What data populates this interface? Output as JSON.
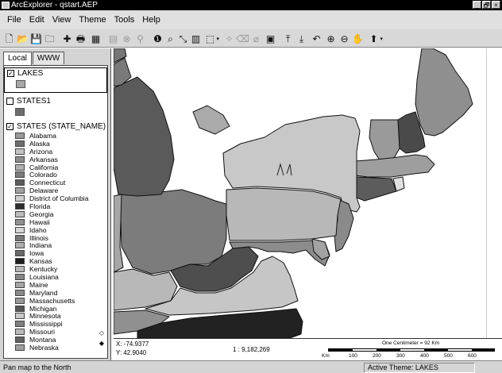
{
  "window": {
    "title": "ArcExplorer - qstart.AEP",
    "controls": [
      "_",
      "🗗",
      "×"
    ]
  },
  "menu": [
    "File",
    "Edit",
    "View",
    "Theme",
    "Tools",
    "Help"
  ],
  "toolbar": [
    {
      "name": "new-icon",
      "glyph": "🗋"
    },
    {
      "name": "open-icon",
      "glyph": "📂"
    },
    {
      "name": "save-icon",
      "glyph": "💾"
    },
    {
      "name": "open-folder-icon",
      "glyph": "🗀"
    },
    {
      "name": "add-theme-icon",
      "glyph": "✚"
    },
    {
      "name": "print-icon",
      "glyph": "🖶"
    },
    {
      "name": "properties-icon",
      "glyph": "▦"
    },
    {
      "name": "table-icon",
      "glyph": "▤",
      "dim": true
    },
    {
      "name": "remove-icon",
      "glyph": "⊗",
      "dim": true
    },
    {
      "name": "query-icon",
      "glyph": "⚲",
      "dim": true
    },
    {
      "name": "identify-icon",
      "glyph": "❶"
    },
    {
      "name": "find-icon",
      "glyph": "⌕"
    },
    {
      "name": "measure-icon",
      "glyph": "⤡"
    },
    {
      "name": "chart-icon",
      "glyph": "▥"
    },
    {
      "name": "select-icon",
      "glyph": "⬚",
      "arrow": true
    },
    {
      "name": "buffer-icon",
      "glyph": "✧",
      "dim": true
    },
    {
      "name": "clear-icon",
      "glyph": "⌫",
      "dim": true
    },
    {
      "name": "erase-icon",
      "glyph": "⌀",
      "dim": true
    },
    {
      "name": "layout-icon",
      "glyph": "▣"
    },
    {
      "name": "export-icon",
      "glyph": "⤒"
    },
    {
      "name": "import-icon",
      "glyph": "⤓"
    },
    {
      "name": "undo-icon",
      "glyph": "↶"
    },
    {
      "name": "zoom-in-icon",
      "glyph": "⊕"
    },
    {
      "name": "zoom-out-icon",
      "glyph": "⊖"
    },
    {
      "name": "pan-icon",
      "glyph": "✋"
    },
    {
      "name": "pan-north-icon",
      "glyph": "⬆",
      "arrow": true
    }
  ],
  "tabs": {
    "local": "Local",
    "www": "WWW"
  },
  "legend": {
    "lakes": {
      "name": "LAKES",
      "checked": true,
      "color": "#a8a8a8"
    },
    "states1": {
      "name": "STATES1",
      "checked": false,
      "color": "#6c6c6c"
    },
    "states": {
      "name": "STATES (STATE_NAME)",
      "checked": true,
      "items": [
        {
          "label": "Alabama",
          "color": "#9a9a9a"
        },
        {
          "label": "Alaska",
          "color": "#6e6e6e"
        },
        {
          "label": "Arizona",
          "color": "#c2c2c2"
        },
        {
          "label": "Arkansas",
          "color": "#8c8c8c"
        },
        {
          "label": "California",
          "color": "#b0b0b0"
        },
        {
          "label": "Colorado",
          "color": "#7a7a7a"
        },
        {
          "label": "Connecticut",
          "color": "#5c5c5c"
        },
        {
          "label": "Delaware",
          "color": "#a2a2a2"
        },
        {
          "label": "District of Columbia",
          "color": "#cfcfcf"
        },
        {
          "label": "Florida",
          "color": "#2c2c2c"
        },
        {
          "label": "Georgia",
          "color": "#bdbdbd"
        },
        {
          "label": "Hawaii",
          "color": "#919191"
        },
        {
          "label": "Idaho",
          "color": "#d6d6d6"
        },
        {
          "label": "Illinois",
          "color": "#777777"
        },
        {
          "label": "Indiana",
          "color": "#adadad"
        },
        {
          "label": "Iowa",
          "color": "#686868"
        },
        {
          "label": "Kansas",
          "color": "#1e1e1e"
        },
        {
          "label": "Kentucky",
          "color": "#b6b6b6"
        },
        {
          "label": "Louisiana",
          "color": "#858585"
        },
        {
          "label": "Maine",
          "color": "#a5a5a5"
        },
        {
          "label": "Maryland",
          "color": "#8a8a8a"
        },
        {
          "label": "Massachusetts",
          "color": "#989898"
        },
        {
          "label": "Michigan",
          "color": "#555555"
        },
        {
          "label": "Minnesota",
          "color": "#c9c9c9"
        },
        {
          "label": "Mississippi",
          "color": "#7e7e7e"
        },
        {
          "label": "Missouri",
          "color": "#b9b9b9"
        },
        {
          "label": "Montana",
          "color": "#626262"
        },
        {
          "label": "Nebraska",
          "color": "#9e9e9e"
        }
      ]
    }
  },
  "map": {
    "states": [
      {
        "name": "state-maine",
        "color": "#8f8f8f"
      },
      {
        "name": "state-new-hampshire",
        "color": "#4a4a4a"
      },
      {
        "name": "state-vermont",
        "color": "#9a9a9a"
      },
      {
        "name": "state-massachusetts",
        "color": "#9e9e9e"
      },
      {
        "name": "state-rhode-island",
        "color": "#e0e0e0"
      },
      {
        "name": "state-connecticut",
        "color": "#5c5c5c"
      },
      {
        "name": "state-new-york",
        "color": "#c8c8c8"
      },
      {
        "name": "state-new-jersey",
        "color": "#8a8a8a"
      },
      {
        "name": "state-pennsylvania",
        "color": "#b8b8b8"
      },
      {
        "name": "state-ohio",
        "color": "#7c7c7c"
      },
      {
        "name": "state-michigan",
        "color": "#5a5a5a"
      },
      {
        "name": "state-indiana",
        "color": "#a6a6a6"
      },
      {
        "name": "state-kentucky",
        "color": "#b8b8b8"
      },
      {
        "name": "state-west-virginia",
        "color": "#4e4e4e"
      },
      {
        "name": "state-virginia",
        "color": "#c6c6c6"
      },
      {
        "name": "state-maryland",
        "color": "#8c8c8c"
      },
      {
        "name": "state-delaware",
        "color": "#a2a2a2"
      },
      {
        "name": "state-north-carolina",
        "color": "#222222"
      },
      {
        "name": "state-tennessee",
        "color": "#909090"
      },
      {
        "name": "state-wisconsin",
        "color": "#7a7a7a"
      },
      {
        "name": "state-illinois",
        "color": "#777777"
      },
      {
        "name": "state-canada-top",
        "color": "#aaaaaa"
      }
    ]
  },
  "coordinates": {
    "x": "X: -74.9377",
    "y": "Y: 42.9040"
  },
  "scale": {
    "ratio": "1 : 9,182,269",
    "one_cm": "One Centimeter = 92 Km",
    "ticks": [
      "Km",
      "100",
      "200",
      "300",
      "400",
      "500",
      "600"
    ]
  },
  "status": {
    "left": "Pan map to the North",
    "right": "Active Theme: LAKES"
  }
}
